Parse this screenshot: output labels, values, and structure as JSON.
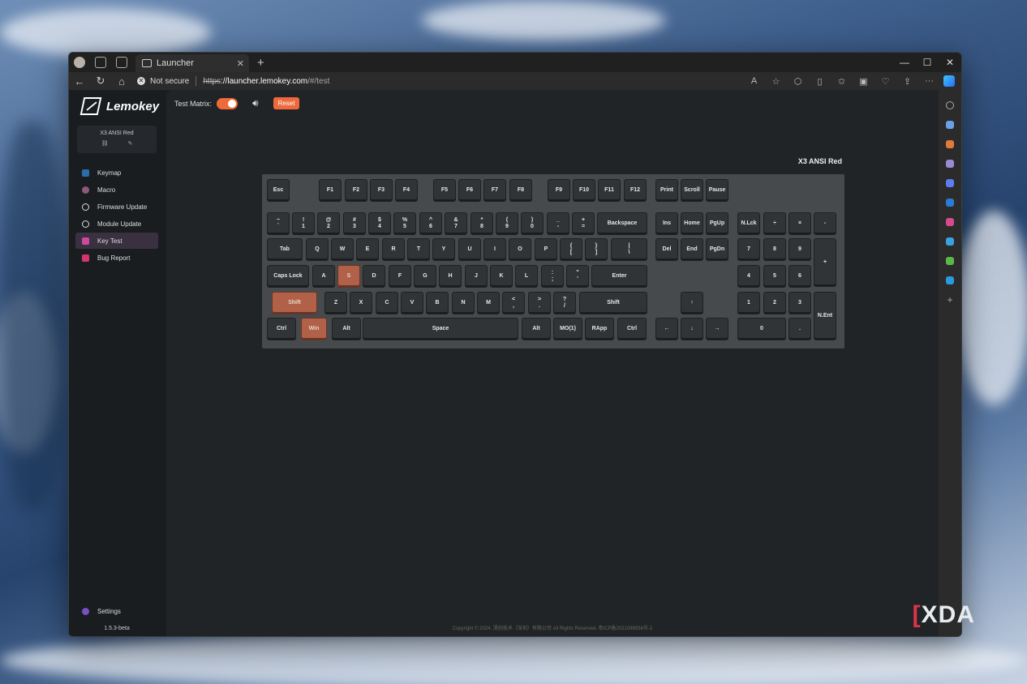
{
  "browser": {
    "tab_title": "Launcher",
    "security_label": "Not secure",
    "url_scheme": "https",
    "url_host": "://launcher.lemokey.com",
    "url_path": "/#/test"
  },
  "sidebar": {
    "logo": "Lemokey",
    "device_name": "X3 ANSI Red",
    "items": [
      {
        "label": "Keymap",
        "icon": "keymap-icon"
      },
      {
        "label": "Macro",
        "icon": "macro-icon"
      },
      {
        "label": "Firmware Update",
        "icon": "firmware-icon"
      },
      {
        "label": "Module Update",
        "icon": "module-icon"
      },
      {
        "label": "Key Test",
        "icon": "keytest-icon",
        "active": true
      },
      {
        "label": "Bug Report",
        "icon": "bug-icon"
      }
    ],
    "settings_label": "Settings",
    "version": "1.5.3-beta"
  },
  "toolbar": {
    "test_matrix_label": "Test Matrix:",
    "test_matrix_on": true,
    "reset_label": "Reset"
  },
  "keyboard": {
    "title": "X3 ANSI Red",
    "pressed_color": "#b26149",
    "keys": [
      {
        "label": "Esc"
      },
      {
        "label": "F1"
      },
      {
        "label": "F2"
      },
      {
        "label": "F3"
      },
      {
        "label": "F4"
      },
      {
        "label": "F5"
      },
      {
        "label": "F6"
      },
      {
        "label": "F7"
      },
      {
        "label": "F8"
      },
      {
        "label": "F9"
      },
      {
        "label": "F10"
      },
      {
        "label": "F11"
      },
      {
        "label": "F12"
      },
      {
        "label": "Print"
      },
      {
        "label": "Scroll"
      },
      {
        "label": "Pause"
      },
      {
        "label": "~",
        "sub": "`"
      },
      {
        "label": "!",
        "sub": "1"
      },
      {
        "label": "@",
        "sub": "2"
      },
      {
        "label": "#",
        "sub": "3"
      },
      {
        "label": "$",
        "sub": "4"
      },
      {
        "label": "%",
        "sub": "5"
      },
      {
        "label": "^",
        "sub": "6"
      },
      {
        "label": "&",
        "sub": "7"
      },
      {
        "label": "*",
        "sub": "8"
      },
      {
        "label": "(",
        "sub": "9"
      },
      {
        "label": ")",
        "sub": "0"
      },
      {
        "label": "_",
        "sub": "-"
      },
      {
        "label": "+",
        "sub": "="
      },
      {
        "label": "Backspace"
      },
      {
        "label": "Ins"
      },
      {
        "label": "Home"
      },
      {
        "label": "PgUp"
      },
      {
        "label": "N.Lck"
      },
      {
        "label": "÷"
      },
      {
        "label": "×"
      },
      {
        "label": "-"
      },
      {
        "label": "Tab"
      },
      {
        "label": "Q"
      },
      {
        "label": "W"
      },
      {
        "label": "E"
      },
      {
        "label": "R"
      },
      {
        "label": "T"
      },
      {
        "label": "Y"
      },
      {
        "label": "U"
      },
      {
        "label": "I"
      },
      {
        "label": "O"
      },
      {
        "label": "P"
      },
      {
        "label": "{",
        "sub": "["
      },
      {
        "label": "}",
        "sub": "]"
      },
      {
        "label": "|",
        "sub": "\\"
      },
      {
        "label": "Del"
      },
      {
        "label": "End"
      },
      {
        "label": "PgDn"
      },
      {
        "label": "7"
      },
      {
        "label": "8"
      },
      {
        "label": "9"
      },
      {
        "label": "+"
      },
      {
        "label": "Caps Lock"
      },
      {
        "label": "A"
      },
      {
        "label": "S",
        "pressed": true
      },
      {
        "label": "D"
      },
      {
        "label": "F"
      },
      {
        "label": "G"
      },
      {
        "label": "H"
      },
      {
        "label": "J"
      },
      {
        "label": "K"
      },
      {
        "label": "L"
      },
      {
        "label": ":",
        "sub": ";"
      },
      {
        "label": "\"",
        "sub": "'"
      },
      {
        "label": "Enter"
      },
      {
        "label": "4"
      },
      {
        "label": "5"
      },
      {
        "label": "6"
      },
      {
        "label": "Shift",
        "pressed": true
      },
      {
        "label": "Z"
      },
      {
        "label": "X"
      },
      {
        "label": "C"
      },
      {
        "label": "V"
      },
      {
        "label": "B"
      },
      {
        "label": "N"
      },
      {
        "label": "M"
      },
      {
        "label": "<",
        "sub": ","
      },
      {
        "label": ">",
        "sub": "."
      },
      {
        "label": "?",
        "sub": "/"
      },
      {
        "label": "Shift"
      },
      {
        "label": "↑"
      },
      {
        "label": "1"
      },
      {
        "label": "2"
      },
      {
        "label": "3"
      },
      {
        "label": "N.Ent"
      },
      {
        "label": "Ctrl"
      },
      {
        "label": "Win",
        "pressed": true
      },
      {
        "label": "Alt"
      },
      {
        "label": "Space"
      },
      {
        "label": "Alt"
      },
      {
        "label": "MO(1)"
      },
      {
        "label": "RApp"
      },
      {
        "label": "Ctrl"
      },
      {
        "label": "←"
      },
      {
        "label": "↓"
      },
      {
        "label": "→"
      },
      {
        "label": "0"
      },
      {
        "label": "."
      }
    ]
  },
  "footer": "Copyright © 2024. 渴创技术（深圳）有限公司 All Rights Reserved. 粤ICP备2021099938号-2",
  "watermark": "XDA"
}
